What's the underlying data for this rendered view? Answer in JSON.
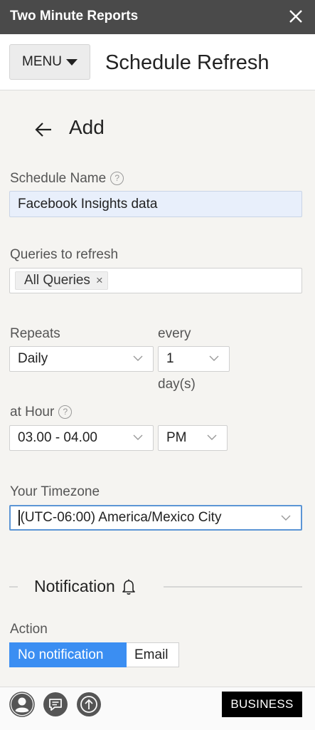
{
  "window": {
    "title": "Two Minute Reports"
  },
  "header": {
    "menu_label": "MENU",
    "title": "Schedule Refresh"
  },
  "section": {
    "title": "Add"
  },
  "schedule_name": {
    "label": "Schedule Name",
    "value": "Facebook Insights data"
  },
  "queries": {
    "label": "Queries to refresh",
    "chip": "All Queries"
  },
  "repeats": {
    "label": "Repeats",
    "value": "Daily"
  },
  "every": {
    "label": "every",
    "value": "1",
    "unit": "day(s)"
  },
  "hour": {
    "label": "at Hour",
    "value": "03.00 - 04.00",
    "ampm": "PM"
  },
  "timezone": {
    "label": "Your Timezone",
    "value": "(UTC-06:00) America/Mexico City"
  },
  "notification": {
    "title": "Notification",
    "action_label": "Action",
    "options": [
      "No notification",
      "Email"
    ],
    "selected": "No notification"
  },
  "footer": {
    "plan_label": "BUSINESS"
  },
  "icons": {
    "close": "close-icon",
    "menu_caret": "caret-down-icon",
    "back": "arrow-left-icon",
    "help": "help-circle-icon",
    "chevron": "chevron-down-icon",
    "bell": "bell-icon",
    "account": "account-icon",
    "feedback": "chat-icon",
    "upgrade": "upgrade-icon"
  },
  "colors": {
    "titlebar": "#4a4a4a",
    "accent": "#3b8ef2",
    "filled_input": "#e8effb",
    "plan_badge": "#000000"
  }
}
